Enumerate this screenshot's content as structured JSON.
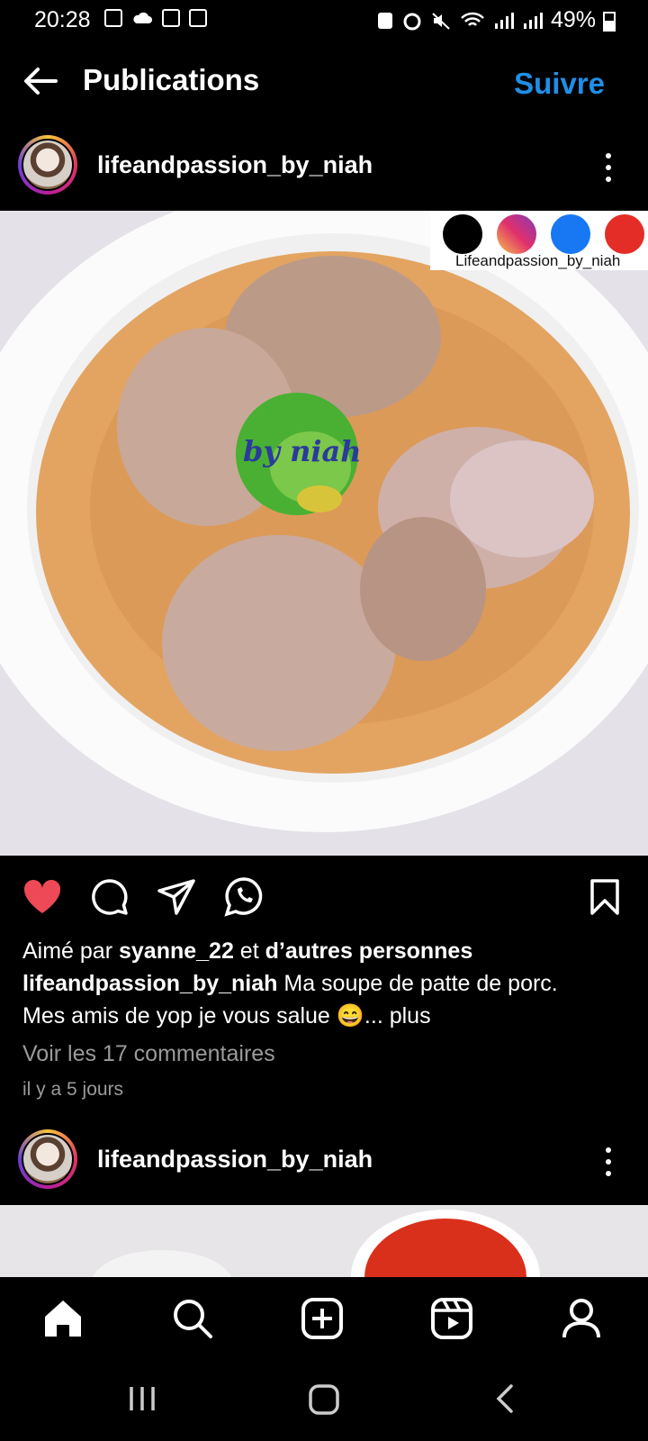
{
  "status_bar": {
    "time": "20:28",
    "battery": "49%"
  },
  "header": {
    "title": "Publications",
    "follow_label": "Suivre"
  },
  "post": {
    "username": "lifeandpassion_by_niah",
    "watermark_handle": "Lifeandpassion_by_niah",
    "watermark_logo": "by niah",
    "liked_by_prefix": "Aimé par ",
    "liked_by_user": "syanne_22",
    "liked_by_mid": " et ",
    "liked_by_others": "d’autres personnes",
    "caption_user": "lifeandpassion_by_niah",
    "caption_text_1": " Ma soupe de patte de porc.",
    "caption_text_2": "Mes amis de yop je vous salue 😄",
    "caption_more": "... plus",
    "view_comments": "Voir les 17 commentaires",
    "timestamp": "il y a 5 jours"
  },
  "next_post": {
    "username": "lifeandpassion_by_niah"
  },
  "colors": {
    "accent": "#1f8fe8",
    "like": "#ed4956",
    "background": "#000000"
  },
  "icons": [
    "back-arrow-icon",
    "heart-icon",
    "comment-icon",
    "share-icon",
    "whatsapp-icon",
    "bookmark-icon",
    "home-icon",
    "search-icon",
    "create-icon",
    "reels-icon",
    "profile-icon"
  ]
}
